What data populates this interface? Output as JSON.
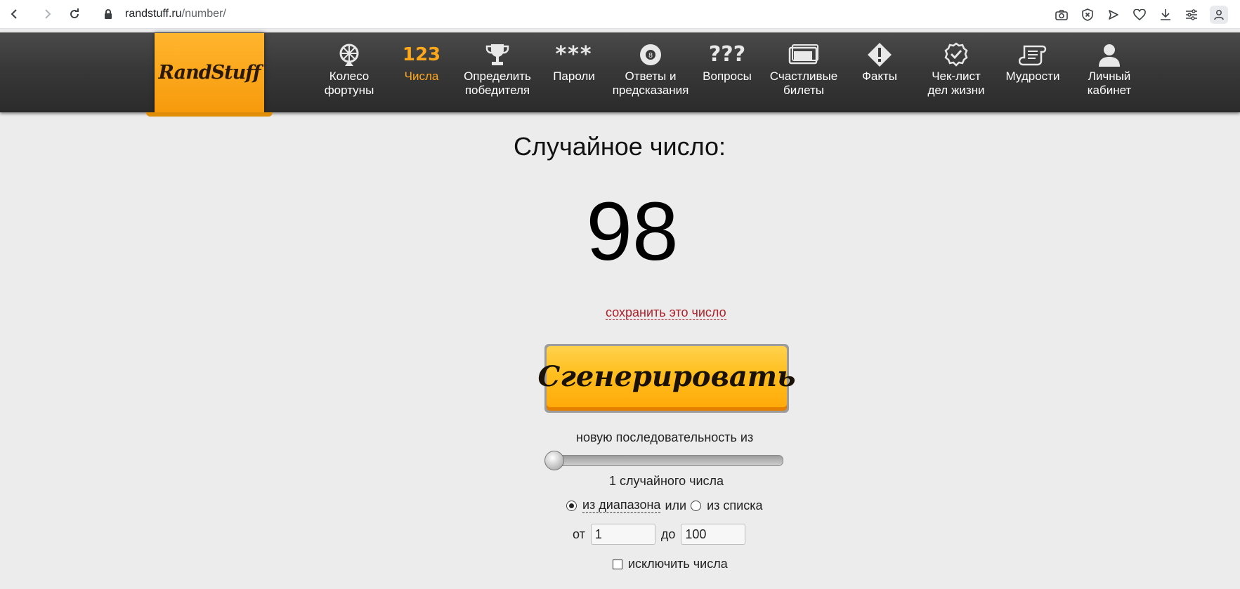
{
  "browser": {
    "url_host": "randstuff.ru",
    "url_path": "/number/"
  },
  "site": {
    "logo": "RandStuff",
    "nav": [
      {
        "label": "Колесо\nфортуны",
        "icon": "wheel-icon",
        "active": false
      },
      {
        "label": "Числа",
        "icon": "numbers-icon",
        "icon_text": "123",
        "active": true
      },
      {
        "label": "Определить\nпобедителя",
        "icon": "trophy-icon",
        "active": false
      },
      {
        "label": "Пароли",
        "icon": "password-icon",
        "icon_text": "***",
        "active": false
      },
      {
        "label": "Ответы и\nпредсказания",
        "icon": "magic-8-ball-icon",
        "active": false
      },
      {
        "label": "Вопросы",
        "icon": "questions-icon",
        "icon_text": "???",
        "active": false
      },
      {
        "label": "Счастливые\nбилеты",
        "icon": "tickets-icon",
        "active": false
      },
      {
        "label": "Факты",
        "icon": "facts-icon",
        "active": false
      },
      {
        "label": "Чек-лист\nдел жизни",
        "icon": "checklist-icon",
        "active": false
      },
      {
        "label": "Мудрости",
        "icon": "scroll-icon",
        "active": false
      },
      {
        "label": "Личный\nкабинет",
        "icon": "user-icon",
        "active": false
      }
    ],
    "accent_color": "#ffa71a"
  },
  "main": {
    "heading": "Случайное число:",
    "result": "98",
    "save_link": "сохранить это число",
    "generate_button": "Сгенерировать",
    "sequence_label": "новую последовательность из",
    "slider_value": 1,
    "count_label": "1 случайного числа",
    "mode_range_label": "из диапазона",
    "mode_or": "или",
    "mode_list_label": "из списка",
    "mode_selected": "range",
    "from_label": "от",
    "from_value": "1",
    "to_label": "до",
    "to_value": "100",
    "exclude_label": "исключить числа"
  }
}
